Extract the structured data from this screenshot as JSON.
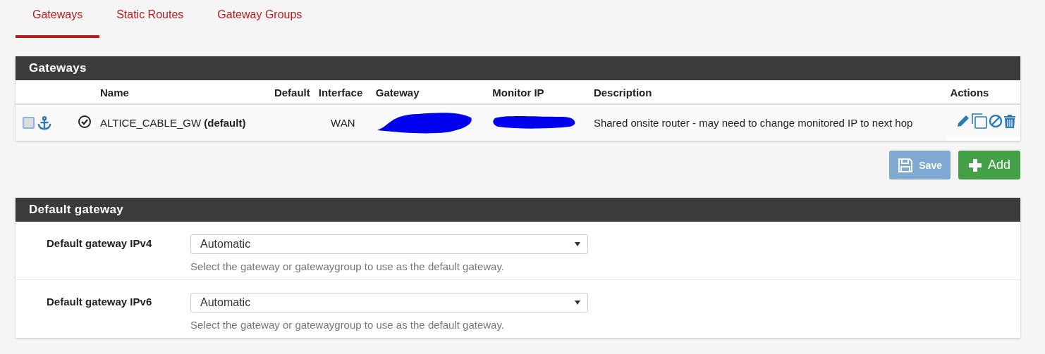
{
  "tabs": [
    {
      "label": "Gateways",
      "selected": true
    },
    {
      "label": "Static Routes",
      "selected": false
    },
    {
      "label": "Gateway Groups",
      "selected": false
    }
  ],
  "gateways_panel": {
    "title": "Gateways",
    "columns": [
      "Name",
      "Default",
      "Interface",
      "Gateway",
      "Monitor IP",
      "Description",
      "Actions"
    ],
    "rows": [
      {
        "checked": false,
        "name": "ALTICE_CABLE_GW **(default)**",
        "interface": "WAN",
        "description": "Shared onsite router - may need to change monitored IP to next hop"
      }
    ]
  },
  "buttons": [
    {
      "label": "Save",
      "kind": "save",
      "disabled": true
    },
    {
      "label": "Add",
      "kind": "add",
      "disabled": false
    }
  ],
  "default_panel": {
    "title": "Default gateway",
    "fields": [
      {
        "label": "Default gateway IPv4",
        "value": "Automatic",
        "help": "Select the gateway or gatewaygroup to use as the default gateway."
      },
      {
        "label": "Default gateway IPv6",
        "value": "Automatic",
        "help": "Select the gateway or gatewaygroup to use as the default gateway."
      }
    ]
  }
}
